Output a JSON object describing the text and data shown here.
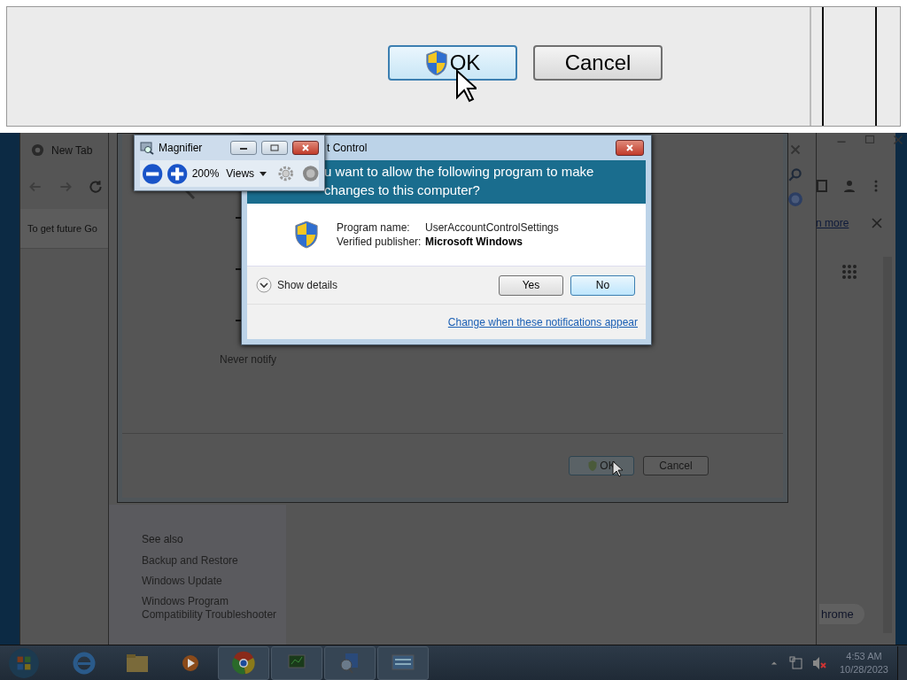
{
  "magnifier_lens": {
    "buttons": [
      {
        "label": "OK",
        "kind": "shield",
        "focused": true
      },
      {
        "label": "Cancel",
        "kind": "plain",
        "focused": false
      }
    ]
  },
  "browser": {
    "tab": "New Tab",
    "infobar": "To get future Go",
    "infobar_link": "n more",
    "bottom_button": "hrome"
  },
  "control_panel": {
    "see_also": "See also",
    "links": [
      "Backup and Restore",
      "Windows Update",
      "Windows Program Compatibility Troubleshooter"
    ]
  },
  "uac_settings": {
    "slider_label": "Never notify",
    "buttons": [
      {
        "label": "OK",
        "kind": "shield",
        "focused": true
      },
      {
        "label": "Cancel",
        "kind": "plain",
        "focused": false
      }
    ]
  },
  "magnifier": {
    "title": "Magnifier",
    "zoom": "200%",
    "views": "Views"
  },
  "uac_dialog": {
    "title": "t Control",
    "heading": "u want to allow the following program to make changes to this computer?",
    "fields": [
      {
        "label": "Program name:",
        "value": "UserAccountControlSettings",
        "bold": false
      },
      {
        "label": "Verified publisher:",
        "value": "Microsoft Windows",
        "bold": true
      }
    ],
    "details": "Show details",
    "buttons": [
      {
        "label": "Yes",
        "default": false
      },
      {
        "label": "No",
        "default": true
      }
    ],
    "link": "Change when these notifications appear"
  },
  "taskbar": {
    "time": "4:53 AM",
    "date": "10/28/2023"
  }
}
